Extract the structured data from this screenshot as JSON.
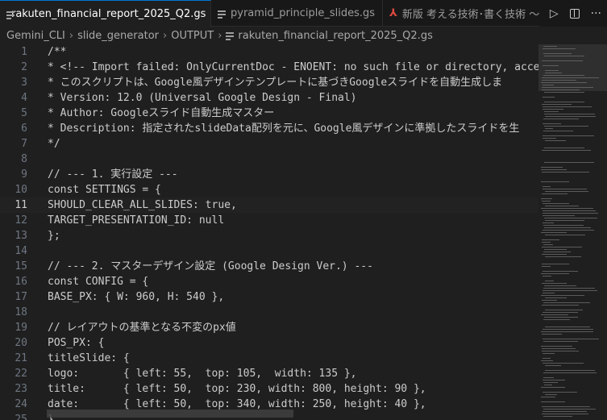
{
  "tabs": [
    {
      "label": "rakuten_financial_report_2025_Q2.gs",
      "icon": "gs-file-icon",
      "active": true,
      "close": "✕"
    },
    {
      "label": "pyramid_principle_slides.gs",
      "icon": "gs-file-icon",
      "active": false
    },
    {
      "label": "新版 考える技術･書く技術 〜問",
      "icon": "pdf-file-icon",
      "active": false
    }
  ],
  "tab_actions": {
    "run": "▷",
    "more": "···"
  },
  "breadcrumb": {
    "items": [
      "Gemini_CLI",
      "slide_generator",
      "OUTPUT",
      "rakuten_financial_report_2025_Q2.gs"
    ],
    "separator": "›"
  },
  "editor": {
    "current_line": 11,
    "lines": [
      {
        "n": "1",
        "text": "/**"
      },
      {
        "n": "2",
        "text": "* <!-- Import failed: OnlyCurrentDoc - ENOENT: no such file or directory, acce"
      },
      {
        "n": "3",
        "text": "* このスクリプトは、Google風デザインテンプレートに基づきGoogleスライドを自動生成しま"
      },
      {
        "n": "4",
        "text": "* Version: 12.0 (Universal Google Design - Final)"
      },
      {
        "n": "5",
        "text": "* Author: Googleスライド自動生成マスター"
      },
      {
        "n": "6",
        "text": "* Description: 指定されたslideData配列を元に、Google風デザインに準拠したスライドを生"
      },
      {
        "n": "7",
        "text": "*/"
      },
      {
        "n": "8",
        "text": ""
      },
      {
        "n": "9",
        "text": "// --- 1. 実行設定 ---"
      },
      {
        "n": "10",
        "text": "const SETTINGS = {"
      },
      {
        "n": "11",
        "text": "SHOULD_CLEAR_ALL_SLIDES: true,"
      },
      {
        "n": "12",
        "text": "TARGET_PRESENTATION_ID: null"
      },
      {
        "n": "13",
        "text": "};"
      },
      {
        "n": "14",
        "text": ""
      },
      {
        "n": "15",
        "text": "// --- 2. マスターデザイン設定 (Google Design Ver.) ---"
      },
      {
        "n": "16",
        "text": "const CONFIG = {"
      },
      {
        "n": "17",
        "text": "BASE_PX: { W: 960, H: 540 },"
      },
      {
        "n": "18",
        "text": ""
      },
      {
        "n": "19",
        "text": "// レイアウトの基準となる不変のpx値"
      },
      {
        "n": "20",
        "text": "POS_PX: {"
      },
      {
        "n": "21",
        "text": "titleSlide: {"
      },
      {
        "n": "22",
        "text": "logo:       { left: 55,  top: 105,  width: 135 },"
      },
      {
        "n": "23",
        "text": "title:      { left: 50,  top: 230, width: 800, height: 90 },"
      },
      {
        "n": "24",
        "text": "date:       { left: 50,  top: 340, width: 250, height: 40 },"
      },
      {
        "n": "25",
        "text": "},"
      }
    ]
  }
}
